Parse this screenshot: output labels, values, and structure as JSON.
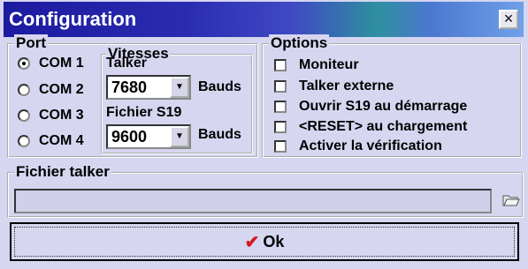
{
  "window": {
    "title": "Configuration",
    "close_label": "×"
  },
  "port": {
    "title": "Port",
    "options": [
      {
        "label": "COM 1",
        "selected": true
      },
      {
        "label": "COM 2",
        "selected": false
      },
      {
        "label": "COM 3",
        "selected": false
      },
      {
        "label": "COM 4",
        "selected": false
      }
    ]
  },
  "speeds": {
    "title": "Vitesses",
    "talker_label": "Talker",
    "talker_value": "7680",
    "fichier_label": "Fichier S19",
    "fichier_value": "9600",
    "unit": "Bauds"
  },
  "options": {
    "title": "Options",
    "items": [
      {
        "label": "Moniteur",
        "checked": false
      },
      {
        "label": "Talker externe",
        "checked": false
      },
      {
        "label": "Ouvrir S19 au démarrage",
        "checked": false
      },
      {
        "label": "<RESET> au chargement",
        "checked": false
      },
      {
        "label": "Activer la vérification",
        "checked": false
      }
    ]
  },
  "file_talker": {
    "title": "Fichier talker",
    "value": ""
  },
  "ok_button": {
    "label": "Ok",
    "check_glyph": "✔"
  },
  "icons": {
    "folder": "folder-open-icon"
  },
  "colors": {
    "title_start": "#1c1aa0",
    "title_end": "#6fa0e8",
    "check": "#d11a1a",
    "window_bg": "#d6d6f0"
  }
}
